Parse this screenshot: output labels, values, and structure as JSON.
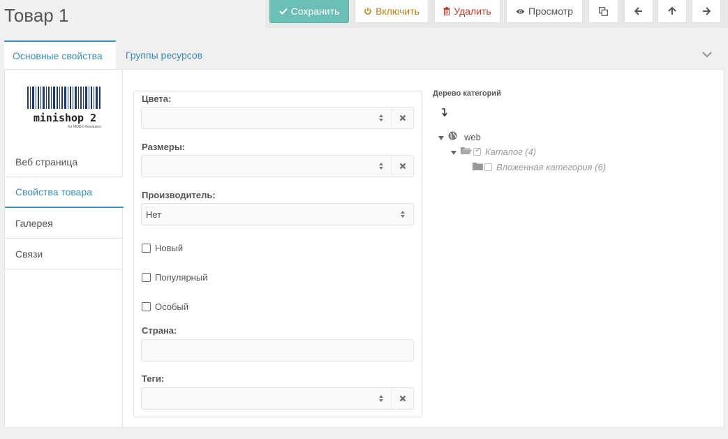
{
  "header": {
    "title": "Товар 1"
  },
  "toolbar": {
    "save_label": "Сохранить",
    "enable_label": "Включить",
    "delete_label": "Удалить",
    "preview_label": "Просмотр"
  },
  "tabs": [
    {
      "label": "Основные свойства"
    },
    {
      "label": "Группы ресурсов"
    }
  ],
  "logo": {
    "text": "minishop 2",
    "subtext": "for MODX Revolution"
  },
  "vertical_tabs": [
    {
      "label": "Веб страница"
    },
    {
      "label": "Свойства товара"
    },
    {
      "label": "Галерея"
    },
    {
      "label": "Связи"
    }
  ],
  "form": {
    "colors_label": "Цвета:",
    "colors_value": "",
    "sizes_label": "Размеры:",
    "sizes_value": "",
    "vendor_label": "Производитель:",
    "vendor_value": "Нет",
    "new_label": "Новый",
    "popular_label": "Популярный",
    "favorite_label": "Особый",
    "country_label": "Страна:",
    "country_value": "",
    "tags_label": "Теги:",
    "tags_value": ""
  },
  "tree": {
    "title": "Дерево категорий",
    "root": "web",
    "catalog": "Каталог (4)",
    "nested": "Вложенная категория (6)"
  },
  "colors": {
    "accent": "#3a8fb5",
    "save": "#6cbfb7",
    "enable": "#b8860b",
    "delete": "#c0392b"
  }
}
